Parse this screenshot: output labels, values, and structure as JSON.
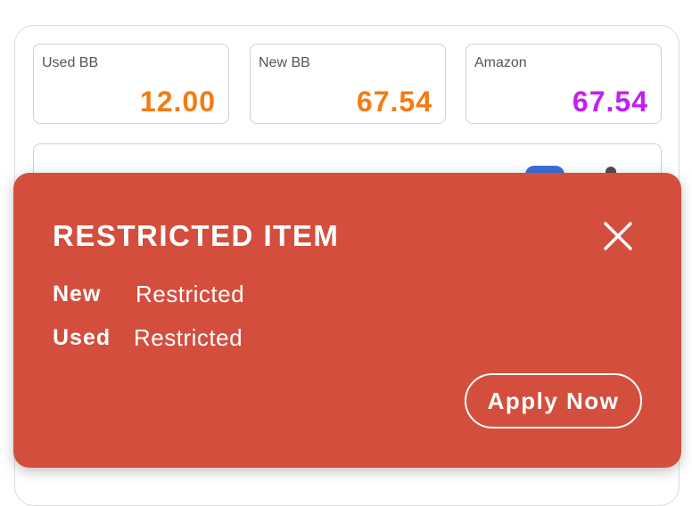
{
  "prices": [
    {
      "label": "Used BB",
      "value": "12.00",
      "color": "#f27c12"
    },
    {
      "label": "New BB",
      "value": "67.54",
      "color": "#f27c12"
    },
    {
      "label": "Amazon",
      "value": "67.54",
      "color": "#c21ef5"
    }
  ],
  "alert": {
    "title": "RESTRICTED ITEM",
    "background": "#d44e3d",
    "close_icon": "close-icon",
    "rows": [
      {
        "key": "New",
        "value": "Restricted"
      },
      {
        "key": "Used",
        "value": "Restricted"
      }
    ],
    "apply_label": "Apply Now"
  }
}
